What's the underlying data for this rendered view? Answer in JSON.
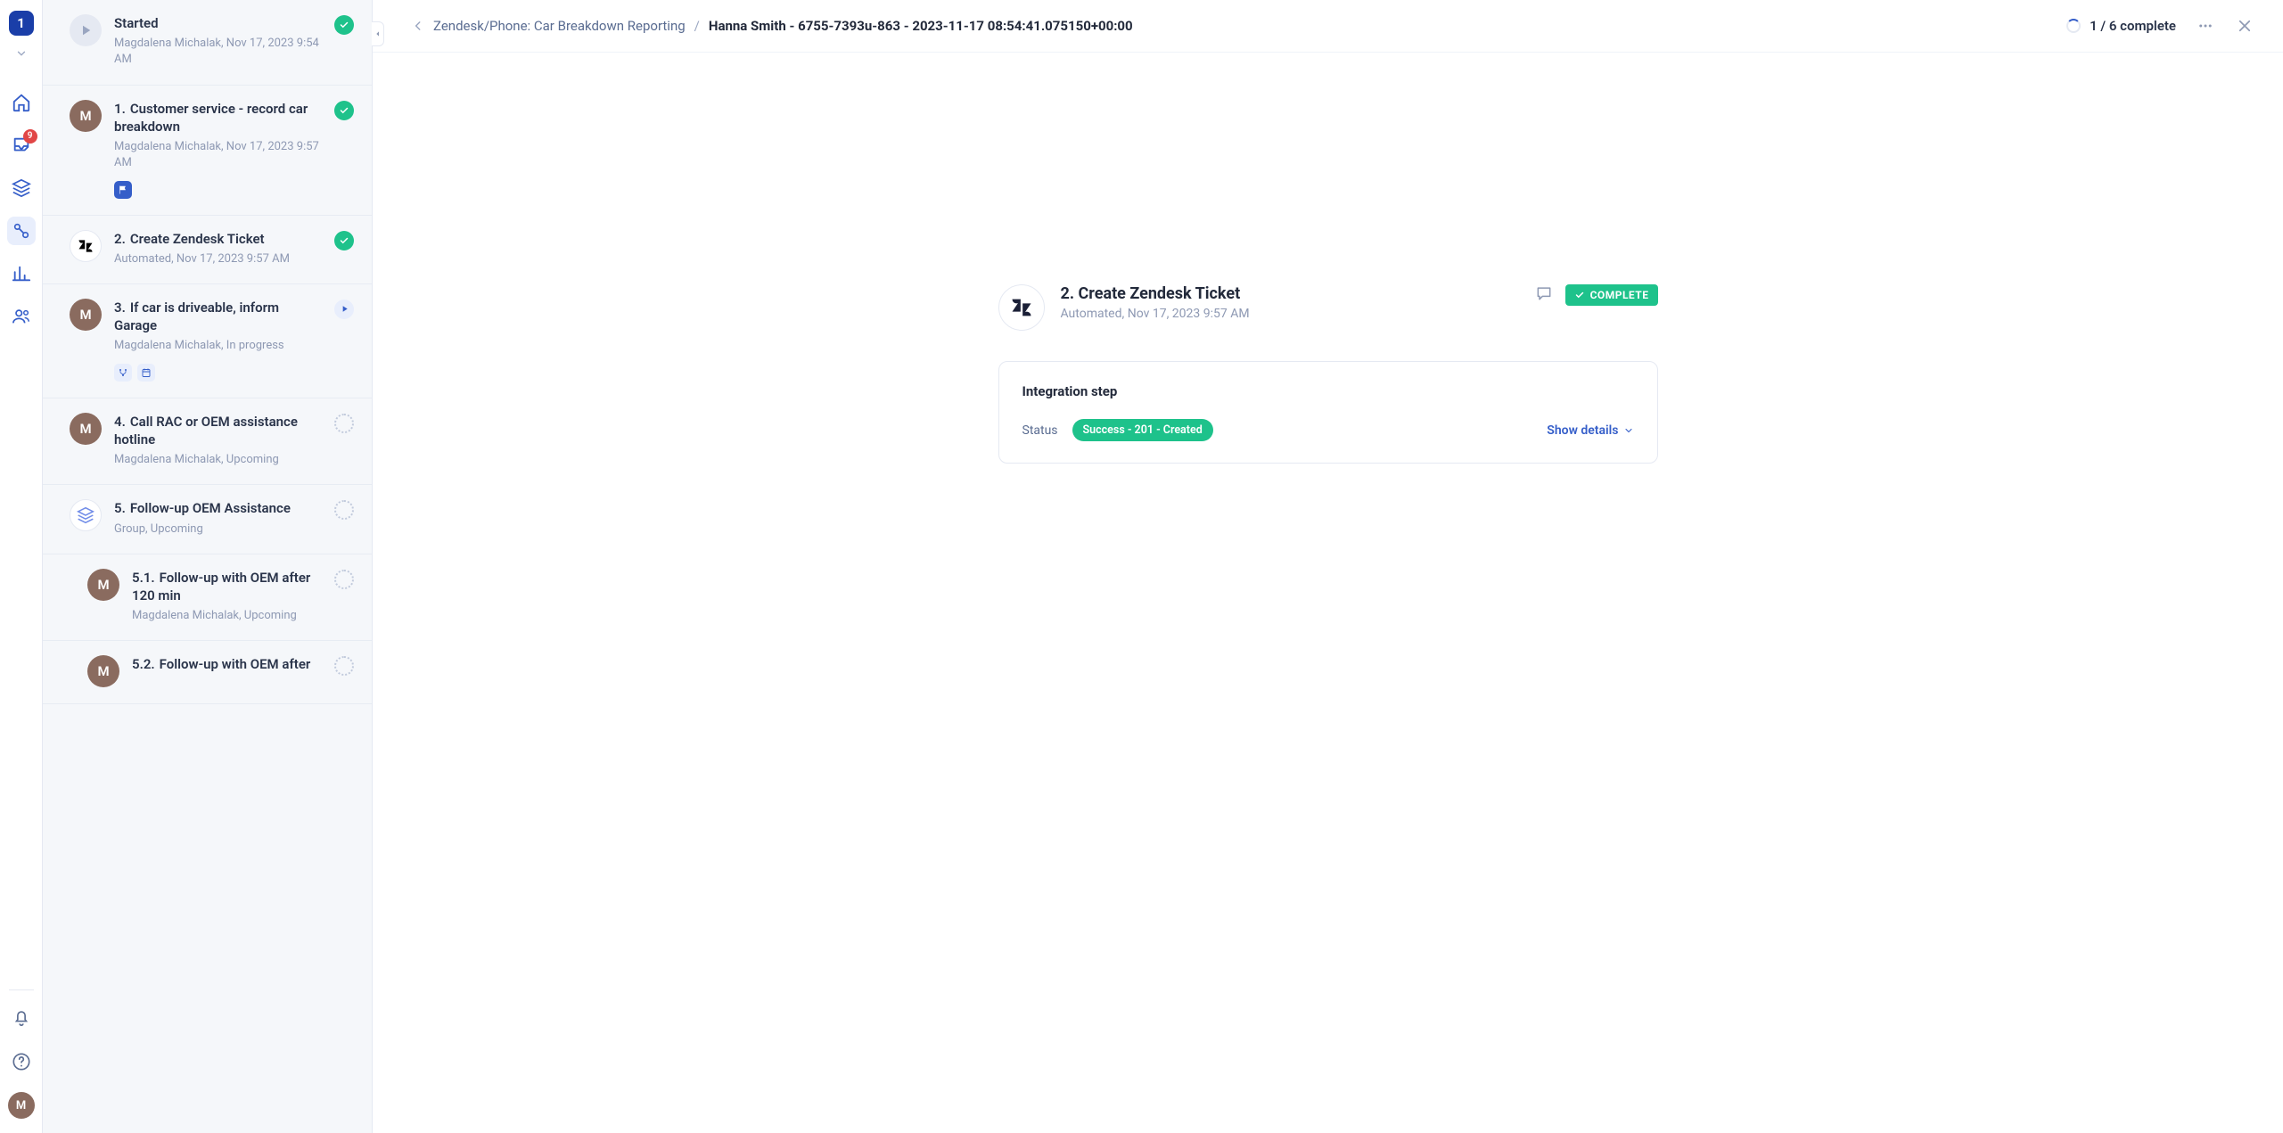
{
  "rail": {
    "workspace_badge": "1",
    "inbox_badge": "9",
    "user_initial": "M"
  },
  "breadcrumb": {
    "parent": "Zendesk/Phone: Car Breakdown Reporting",
    "current": "Hanna Smith - 6755-7393u-863 - 2023-11-17 08:54:41.075150+00:00"
  },
  "progress": "1 / 6 complete",
  "steps": [
    {
      "avatar": "play-grey",
      "title": "Started",
      "meta": "Magdalena Michalak, Nov 17, 2023 9:54 AM",
      "status": "complete"
    },
    {
      "avatar": "M",
      "num": "1.",
      "title": "Customer service - record car breakdown",
      "meta": "Magdalena Michalak, Nov 17, 2023 9:57 AM",
      "status": "complete",
      "chips": [
        "flag"
      ]
    },
    {
      "avatar": "zendesk",
      "num": "2.",
      "title": "Create Zendesk Ticket",
      "meta": "Automated, Nov 17, 2023 9:57 AM",
      "status": "complete"
    },
    {
      "avatar": "M",
      "num": "3.",
      "title": "If car is driveable, inform Garage",
      "meta": "Magdalena Michalak, In progress",
      "status": "active",
      "chips": [
        "branch",
        "calendar"
      ]
    },
    {
      "avatar": "M",
      "num": "4.",
      "title": "Call RAC or OEM assistance hotline",
      "meta": "Magdalena Michalak, Upcoming",
      "status": "upcoming"
    },
    {
      "avatar": "stack",
      "num": "5.",
      "title": "Follow-up OEM Assistance",
      "meta": "Group, Upcoming",
      "status": "upcoming"
    },
    {
      "avatar": "M",
      "num": "5.1.",
      "title": "Follow-up with OEM after 120 min",
      "meta": "Magdalena Michalak, Upcoming",
      "status": "upcoming",
      "indent": true
    },
    {
      "avatar": "M",
      "num": "5.2.",
      "title": "Follow-up with OEM after",
      "meta": "",
      "status": "upcoming",
      "indent": true
    }
  ],
  "detail": {
    "title": "2. Create Zendesk Ticket",
    "meta": "Automated, Nov 17, 2023 9:57 AM",
    "badge": "COMPLETE",
    "card_title": "Integration step",
    "status_label": "Status",
    "status_value": "Success - 201 - Created",
    "show_details": "Show details"
  }
}
